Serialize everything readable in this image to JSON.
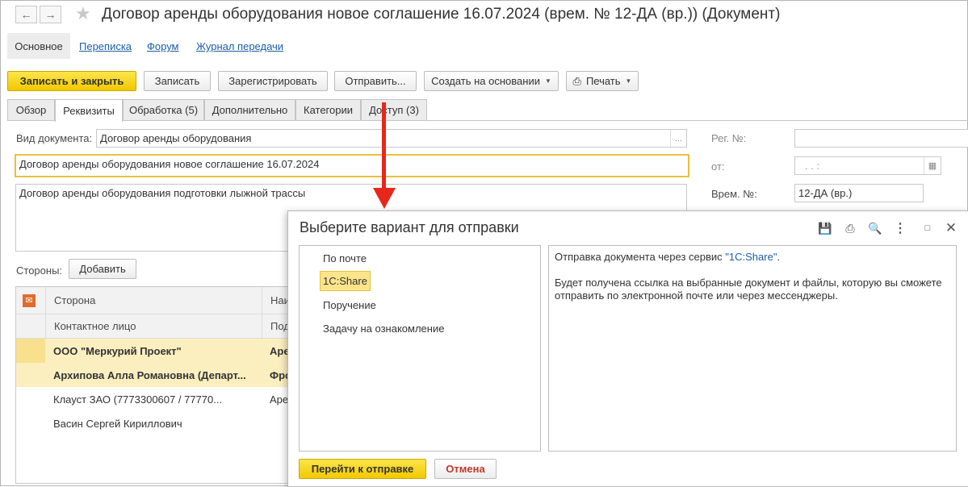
{
  "window": {
    "title": "Договор аренды оборудования новое соглашение 16.07.2024 (врем. № 12-ДА (вр.)) (Документ)"
  },
  "sections": {
    "active": "Основное",
    "links": [
      "Переписка",
      "Форум",
      "Журнал передачи"
    ]
  },
  "toolbar": {
    "save_close": "Записать и закрыть",
    "save": "Записать",
    "register": "Зарегистрировать",
    "send": "Отправить...",
    "create_based": "Создать на основании",
    "print": "Печать"
  },
  "tabs": [
    {
      "label": "Обзор"
    },
    {
      "label": "Реквизиты"
    },
    {
      "label": "Обработка (5)"
    },
    {
      "label": "Дополнительно"
    },
    {
      "label": "Категории"
    },
    {
      "label": "Доступ (3)"
    }
  ],
  "form": {
    "doc_type_label": "Вид документа:",
    "doc_type_value": "Договор аренды оборудования",
    "subject_value": "Договор аренды оборудования новое соглашение 16.07.2024",
    "summary_value": "Договор аренды оборудования подготовки лыжной трассы",
    "reg_no_label": "Рег. №:",
    "reg_no_value": "",
    "from_label": "от:",
    "from_value": ". .   :",
    "temp_no_label": "Врем. №:",
    "temp_no_value": "12-ДА (вр.)",
    "parties_label": "Стороны:",
    "add_button": "Добавить"
  },
  "parties_table": {
    "col1_header": "Сторона",
    "col1_subheader": "Контактное лицо",
    "col2_header": "Наи",
    "col2_subheader": "Под",
    "rows": [
      {
        "c1": "ООО \"Меркурий Проект\"",
        "c2": "Аре",
        "bold": true
      },
      {
        "c1": "Архипова Алла Романовна (Департ...",
        "c2": "Фро",
        "bold": true
      },
      {
        "c1": "Клауст ЗАО (7773300607 / 77770...",
        "c2": "Аре",
        "bold": false
      },
      {
        "c1": "Васин Сергей Кириллович",
        "c2": "",
        "bold": false
      }
    ]
  },
  "dialog": {
    "title": "Выберите вариант для отправки",
    "options": [
      "По почте",
      "1С:Share",
      "Поручение",
      "Задачу на ознакомление"
    ],
    "selected": "1С:Share",
    "desc_prefix": "Отправка документа через сервис ",
    "desc_link": "\"1С:Share\"",
    "desc_suffix": ".",
    "desc_body": "Будет получена ссылка на выбранные документ и файлы, которую вы сможете отправить по электронной почте или через мессенджеры.",
    "go_button": "Перейти к отправке",
    "cancel_button": "Отмена"
  },
  "colors": {
    "accent_yellow": "#f2c800",
    "link_blue": "#1c5fa7",
    "arrow_red": "#e8271c",
    "cancel_red": "#c0392b"
  }
}
